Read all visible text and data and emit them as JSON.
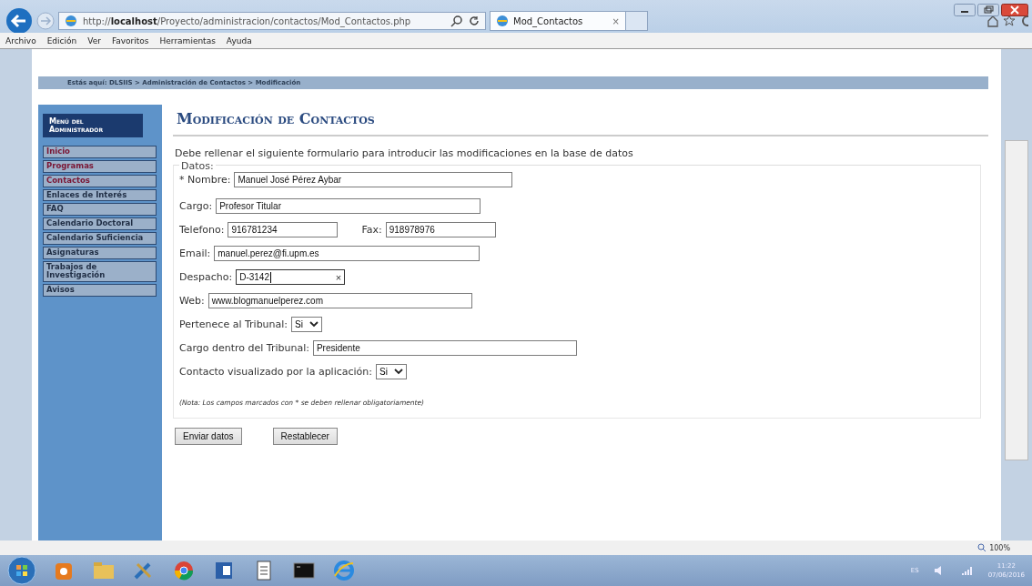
{
  "browser": {
    "url_prefix": "http://",
    "url_host": "localhost",
    "url_path": "/Proyecto/administracion/contactos/Mod_Contactos.php",
    "tab": {
      "title": "Mod_Contactos",
      "close": "×",
      "selected": true
    },
    "menu": [
      "Archivo",
      "Edición",
      "Ver",
      "Favoritos",
      "Herramientas",
      "Ayuda"
    ],
    "zoom": "100%"
  },
  "breadcrumb": "Estás aquí: DLSIIS >  Administración de Contactos >  Modificación",
  "sidebar": {
    "title": "Menú del Administrador",
    "items": [
      {
        "label": "Inicio",
        "visited": true
      },
      {
        "label": "Programas",
        "visited": true
      },
      {
        "label": "Contactos",
        "visited": true
      },
      {
        "label": "Enlaces de Interés",
        "visited": false
      },
      {
        "label": "FAQ",
        "visited": false
      },
      {
        "label": "Calendario Doctoral",
        "visited": false
      },
      {
        "label": "Calendario Suficiencia",
        "visited": false
      },
      {
        "label": "Asignaturas",
        "visited": false
      },
      {
        "label": "Trabajos de Investigación",
        "visited": false
      },
      {
        "label": "Avisos",
        "visited": false
      }
    ]
  },
  "page": {
    "title": "Modificación de Contactos",
    "intro": "Debe rellenar el siguiente formulario para introducir las modificaciones en la base de datos",
    "fieldset": "Datos:",
    "rows": [
      [
        {
          "kind": "text",
          "label": "* Nombre:",
          "value": "Manuel José Pérez Aybar"
        }
      ],
      [
        {
          "kind": "text",
          "label": "Cargo:",
          "value": "Profesor Titular"
        }
      ],
      [
        {
          "kind": "text",
          "label": "Telefono:",
          "value": "916781234"
        },
        {
          "kind": "text",
          "label": "Fax:",
          "value": "918978976"
        }
      ],
      [
        {
          "kind": "text",
          "label": "Email:",
          "value": "manuel.perez@fi.upm.es"
        }
      ],
      [
        {
          "kind": "text",
          "label": "Despacho:",
          "value": "D-3142",
          "focused": true,
          "clear": "×"
        }
      ],
      [
        {
          "kind": "text",
          "label": "Web:",
          "value": "www.blogmanuelperez.com"
        }
      ],
      [
        {
          "kind": "select",
          "label": "Pertenece al Tribunal:",
          "value": "Si"
        }
      ],
      [
        {
          "kind": "text",
          "label": "Cargo dentro del Tribunal:",
          "value": "Presidente"
        }
      ],
      [
        {
          "kind": "select",
          "label": "Contacto visualizado por la aplicación:",
          "value": "Si"
        }
      ]
    ],
    "note": "(Nota: Los campos marcados con * se deben rellenar obligatoriamente)",
    "buttons": [
      "Enviar datos",
      "Restablecer"
    ]
  },
  "taskbar": {
    "lang": "ES",
    "time": "11:22",
    "date": "07/06/2016"
  }
}
